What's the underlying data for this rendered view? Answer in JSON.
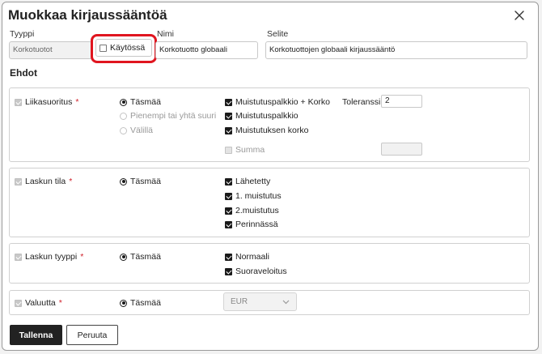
{
  "dialog": {
    "title": "Muokkaa kirjaussääntöä"
  },
  "fields": {
    "tyyppi": {
      "label": "Tyyppi",
      "value": "Korkotuotot"
    },
    "kaytossa": {
      "label": "Käytössä",
      "checked": false
    },
    "nimi": {
      "label": "Nimi",
      "value": "Korkotuotto globaali"
    },
    "selite": {
      "label": "Selite",
      "value": "Korkotuottojen globaali kirjaussääntö"
    }
  },
  "conditions_heading": "Ehdot",
  "required_marker": "*",
  "sections": {
    "liikasuoritus": {
      "label": "Liikasuoritus",
      "radios": [
        "Täsmää",
        "Pienempi tai yhtä suuri",
        "Välillä"
      ],
      "checks": [
        "Muistutuspalkkio + Korko",
        "Muistutuspalkkio",
        "Muistutuksen korko",
        "Summa"
      ],
      "tolerance_label": "Toleranssi",
      "tolerance_value": "2"
    },
    "laskun_tila": {
      "label": "Laskun tila",
      "radio": "Täsmää",
      "checks": [
        "Lähetetty",
        "1. muistutus",
        "2.muistutus",
        "Perinnässä"
      ]
    },
    "laskun_tyyppi": {
      "label": "Laskun tyyppi",
      "radio": "Täsmää",
      "checks": [
        "Normaali",
        "Suoraveloitus"
      ]
    },
    "valuutta": {
      "label": "Valuutta",
      "radio": "Täsmää",
      "select_value": "EUR"
    }
  },
  "buttons": {
    "save": "Tallenna",
    "cancel": "Peruuta"
  }
}
